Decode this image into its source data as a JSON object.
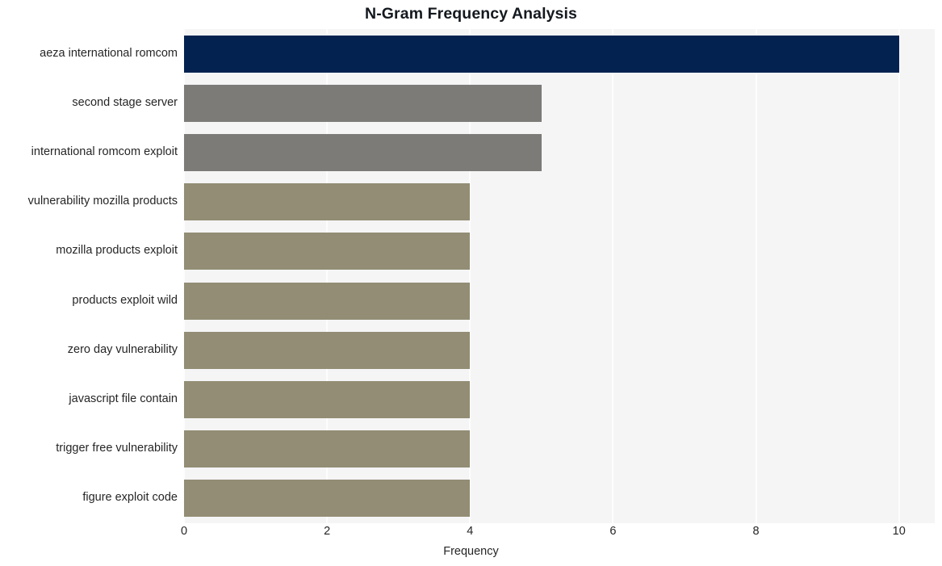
{
  "chart_data": {
    "type": "bar",
    "orientation": "horizontal",
    "title": "N-Gram Frequency Analysis",
    "xlabel": "Frequency",
    "ylabel": "",
    "xlim": [
      0,
      10.5
    ],
    "xticks": [
      0,
      2,
      4,
      6,
      8,
      10
    ],
    "xtick_labels": [
      "0",
      "2",
      "4",
      "6",
      "8",
      "10"
    ],
    "grid": "vertical",
    "legend": "none",
    "categories": [
      "aeza international romcom",
      "second stage server",
      "international romcom exploit",
      "vulnerability mozilla products",
      "mozilla products exploit",
      "products exploit wild",
      "zero day vulnerability",
      "javascript file contain",
      "trigger free vulnerability",
      "figure exploit code"
    ],
    "values": [
      10,
      5,
      5,
      4,
      4,
      4,
      4,
      4,
      4,
      4
    ],
    "bar_colors": [
      "#04224f",
      "#7c7b78",
      "#7c7b78",
      "#928d74",
      "#928d74",
      "#928d74",
      "#928d74",
      "#928d74",
      "#928d74",
      "#928d74"
    ],
    "plot_background": "#f5f5f6",
    "figure_background": "#ffffff",
    "gridline_color": "#fdfdfe",
    "text_color": "#262626",
    "title_color": "#14191f"
  }
}
